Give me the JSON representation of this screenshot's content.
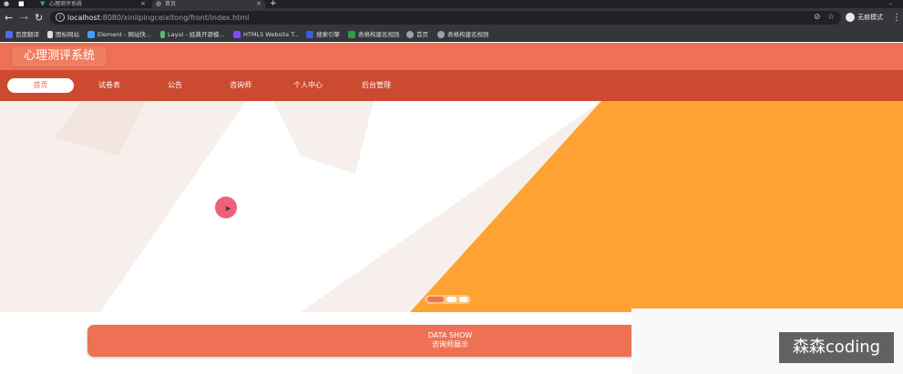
{
  "browser": {
    "tabs": [
      {
        "title": "心理测评系统",
        "active": false
      },
      {
        "title": "首页",
        "active": true
      }
    ],
    "new_tab_icon": "+",
    "address": {
      "host": "localhost",
      "path": ":8080/xinlipingceixitong/front/index.html"
    },
    "profile_label": "无痕模式",
    "bookmarks": [
      {
        "label": "百度翻译",
        "color": "#4e6ef2"
      },
      {
        "label": "图标网站",
        "color": "#dadce0"
      },
      {
        "label": "Element - 网站快...",
        "color": "#409eff"
      },
      {
        "label": "Layui - 经典开源模...",
        "color": "#5fb878"
      },
      {
        "label": "HTML5 Website T...",
        "color": "#7c4dff"
      },
      {
        "label": "搜索引擎",
        "color": "#3b5bdb"
      },
      {
        "label": "表格构建名规则",
        "color": "#2e9d4a"
      },
      {
        "label": "首页",
        "color": "#9aa0a6"
      },
      {
        "label": "表格构建名规则",
        "color": "#9aa0a6"
      }
    ]
  },
  "site": {
    "title": "心理测评系统",
    "nav": [
      {
        "label": "首页",
        "active": true
      },
      {
        "label": "试卷表",
        "active": false
      },
      {
        "label": "公告",
        "active": false
      },
      {
        "label": "咨询师",
        "active": false
      },
      {
        "label": "个人中心",
        "active": false
      },
      {
        "label": "后台管理",
        "active": false
      }
    ],
    "carousel": {
      "slides": 3,
      "active": 0
    },
    "data_show": {
      "en": "DATA SHOW",
      "cn": "咨询师展示"
    }
  },
  "watermark": "森森coding",
  "colors": {
    "header": "#ee7155",
    "nav": "#cb4a30",
    "banner_orange": "#fda233",
    "banner_bg": "#f6efeb"
  }
}
